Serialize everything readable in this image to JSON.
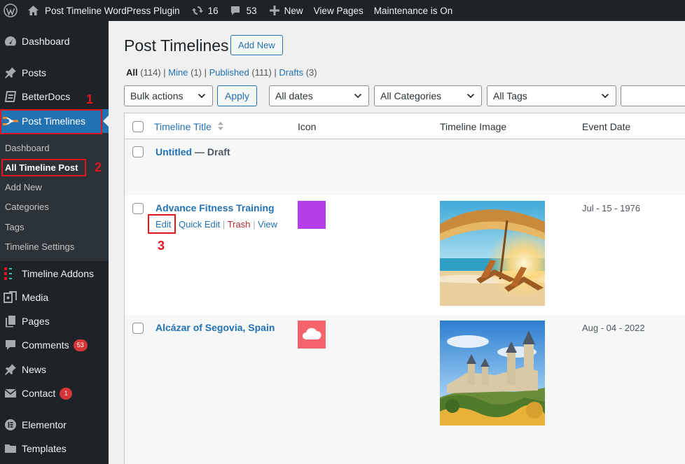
{
  "adminbar": {
    "site_name": "Post Timeline WordPress Plugin",
    "updates_count": "16",
    "comments_count": "53",
    "new_label": "New",
    "view_pages_label": "View Pages",
    "maintenance_label": "Maintenance is On"
  },
  "sidebar": {
    "dashboard": "Dashboard",
    "posts": "Posts",
    "betterdocs": "BetterDocs",
    "post_timelines": "Post Timelines",
    "submenu": {
      "dashboard": "Dashboard",
      "all_timeline_post": "All Timeline Post",
      "add_new": "Add New",
      "categories": "Categories",
      "tags": "Tags",
      "timeline_settings": "Timeline Settings"
    },
    "timeline_addons": "Timeline Addons",
    "media": "Media",
    "pages": "Pages",
    "comments": "Comments",
    "comments_badge": "53",
    "news": "News",
    "contact": "Contact",
    "contact_badge": "1",
    "elementor": "Elementor",
    "templates": "Templates"
  },
  "callouts": {
    "one": "1",
    "two": "2",
    "three": "3"
  },
  "main": {
    "page_title": "Post Timelines",
    "add_new_label": "Add New",
    "filters": {
      "all_label": "All",
      "all_count": "(114)",
      "mine_label": "Mine",
      "mine_count": "(1)",
      "published_label": "Published",
      "published_count": "(111)",
      "drafts_label": "Drafts",
      "drafts_count": "(3)",
      "sep": "|"
    },
    "bulk_actions": "Bulk actions",
    "apply_label": "Apply",
    "all_dates": "All dates",
    "all_categories": "All Categories",
    "all_tags": "All Tags"
  },
  "table": {
    "columns": {
      "title": "Timeline Title",
      "icon": "Icon",
      "image": "Timeline Image",
      "date": "Event Date"
    },
    "rows": [
      {
        "title": "Untitled",
        "state": " — Draft"
      },
      {
        "title": "Advance Fitness Training",
        "date": "Jul - 15 - 1976",
        "actions": {
          "edit": "Edit",
          "quick_edit": "Quick Edit",
          "trash": "Trash",
          "view": "View",
          "sep": "|"
        }
      },
      {
        "title": "Alcázar of Segovia, Spain",
        "date": "Aug - 04 - 2022"
      }
    ]
  },
  "colors": {
    "accent": "#2271b1",
    "sidebar_bg": "#1d2327",
    "submenu_bg": "#2c3338",
    "badge": "#d63638",
    "callout": "#e0161e",
    "icon_purple": "#b43ee8",
    "icon_coral": "#f5646a"
  },
  "icons": {
    "wp_logo": "wordpress-logo-icon",
    "home": "home-icon",
    "updates": "updates-icon",
    "comments": "comment-bubble-icon",
    "plus": "plus-icon"
  }
}
